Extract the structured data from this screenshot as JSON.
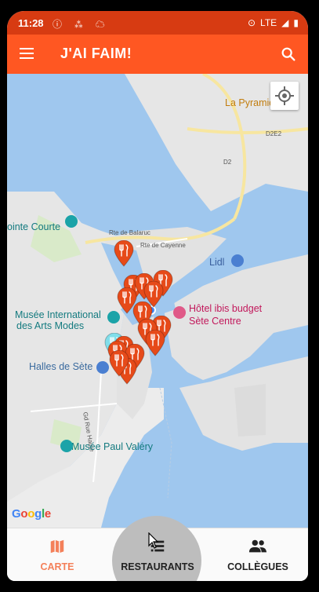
{
  "status_bar": {
    "time": "11:28",
    "network": "LTE",
    "icons": [
      "info-icon",
      "location-icon",
      "signal-icon",
      "battery-icon"
    ]
  },
  "app_bar": {
    "title": "J'AI FAIM!",
    "menu_icon": "menu-icon",
    "search_icon": "search-icon"
  },
  "map": {
    "labels": {
      "la_pyramide": "La Pyramide",
      "d2e2": "D2E2",
      "d2": "D2",
      "pointe_courte": "ointe Courte",
      "rte_balaruc": "Rte de Balaruc",
      "rte_cayenne": "Rte de Cayenne",
      "lidl": "Lidl",
      "musee_intl_1": "Musée International",
      "musee_intl_2": "des Arts Modes",
      "hotel_1": "Hôtel ibis budget",
      "hotel_2": "Sète Centre",
      "halles": "Halles de Sète",
      "rue": "Gd Rue Haute",
      "musee_valery": "Musée Paul Valéry",
      "google": "Google"
    },
    "restaurant_pins_count": 16,
    "selected_pin_color": "#80deea",
    "pin_color": "#e64a19"
  },
  "bottom_nav": {
    "items": [
      {
        "label": "CARTE",
        "icon": "map-icon",
        "active": true
      },
      {
        "label": "RESTAURANTS",
        "icon": "list-icon",
        "active": false
      },
      {
        "label": "COLLÈGUES",
        "icon": "people-icon",
        "active": false
      }
    ],
    "accent": "#f4805a"
  },
  "colors": {
    "status_bar": "#d73b12",
    "app_bar": "#ff5722",
    "water": "#9fc7ee",
    "land": "#e8e8e8"
  }
}
